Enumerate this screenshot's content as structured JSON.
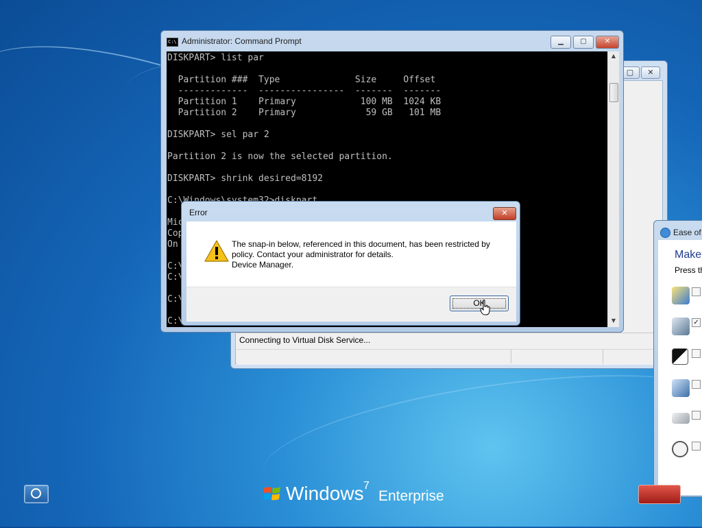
{
  "cmd": {
    "title": "Administrator: Command Prompt",
    "icon_text": "C:\\",
    "minimize": "▁",
    "maximize": "▢",
    "close": "✕",
    "console_text": "DISKPART> list par\n\n  Partition ###  Type              Size     Offset\n  -------------  ----------------  -------  -------\n  Partition 1    Primary            100 MB  1024 KB\n  Partition 2    Primary             59 GB   101 MB\n\nDISKPART> sel par 2\n\nPartition 2 is now the selected partition.\n\nDISKPART> shrink desired=8192\n\nC:\\Windows\\system32>diskpart\n\nMic\nCop\nOn \n\nC:\\\nC:\\\n\nC:\\\n\nC:\\"
  },
  "back_window": {
    "maximize": "▢",
    "close": "✕",
    "status": "Connecting to Virtual Disk Service..."
  },
  "error_dialog": {
    "title": "Error",
    "close": "✕",
    "message": "The snap-in below, referenced in this document, has been restricted by\npolicy. Contact your administrator for details.\nDevice Manager.",
    "ok": "OK",
    "icon": "warning-icon"
  },
  "ease": {
    "title": "Ease of Access",
    "heading": "Make",
    "subheading": "Press th",
    "options": [
      {
        "icon": "narrator-icon",
        "checked": ""
      },
      {
        "icon": "magnifier-icon",
        "checked": "✓"
      },
      {
        "icon": "high-contrast-icon",
        "checked": ""
      },
      {
        "icon": "on-screen-keyboard-icon",
        "checked": ""
      },
      {
        "icon": "sticky-keys-icon",
        "checked": ""
      },
      {
        "icon": "filter-keys-timer-icon",
        "checked": ""
      }
    ]
  },
  "branding": {
    "windows": "Windows",
    "version": "7",
    "edition": "Enterprise"
  },
  "colors": {
    "desktop": "#1566b8",
    "console_bg": "#000000",
    "console_fg": "#c0c0c0",
    "dialog_close": "#c23f26",
    "ease_heading": "#1e3b8c"
  }
}
